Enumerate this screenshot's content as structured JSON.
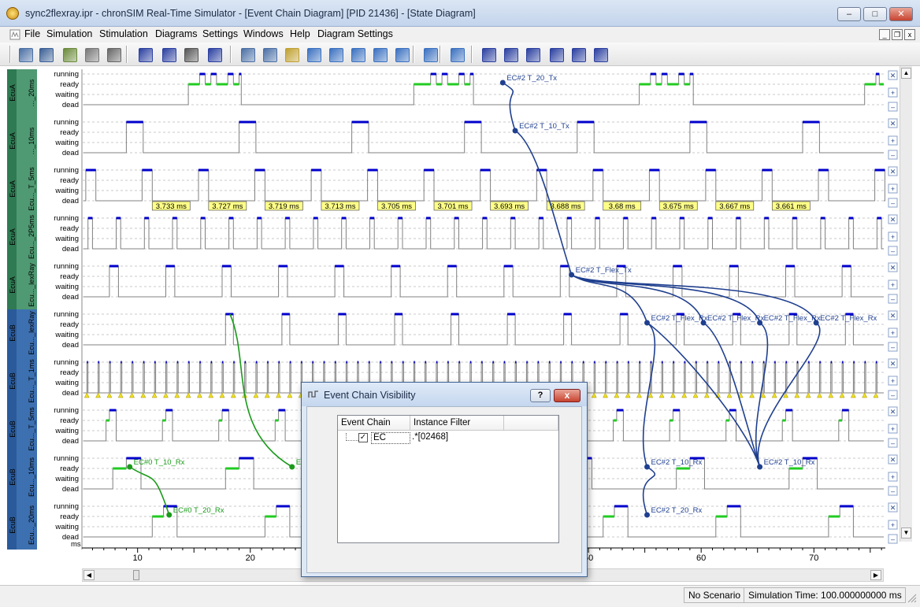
{
  "window": {
    "title": "sync2flexray.ipr - chronSIM Real-Time Simulator - [Event Chain Diagram] [PID 21436] - [State Diagram]",
    "minimize_label": "–",
    "maximize_label": "□",
    "close_label": "✕"
  },
  "menu": {
    "items": [
      "File",
      "Simulation",
      "Stimulation",
      "Diagrams",
      "Settings",
      "Windows",
      "Help",
      "Diagram Settings"
    ],
    "mdi_min": "_",
    "mdi_restore": "❐",
    "mdi_close": "x"
  },
  "toolbar": {
    "icons": [
      "open-project-icon",
      "save-tvc-icon",
      "settings-check-icon",
      "report-icon",
      "print-icon",
      "run-fast-icon",
      "step-icon",
      "pause-icon",
      "stop-icon",
      "state-diagram-icon",
      "text-diagram-icon",
      "chain-diagram-icon",
      "histogram-icon",
      "boxplot-icon",
      "curve-icon",
      "timeline-icon",
      "bracket-icon",
      "waveform-icon",
      "eye-icon",
      "add-row-icon",
      "remove-row-icon",
      "stack-icon",
      "zoom-in-icon",
      "zoom-out-icon",
      "menu-icon"
    ]
  },
  "chart_data": {
    "type": "state-diagram",
    "x_unit": "ms",
    "x_range": [
      5.2,
      76.2
    ],
    "x_ticks": [
      10,
      20,
      30,
      40,
      50,
      60,
      70
    ],
    "state_labels": [
      "running",
      "ready",
      "waiting",
      "dead"
    ],
    "colors": {
      "running": "#0000cc",
      "ready": "#22cc22",
      "event_chain_blue": "#1f3f8f",
      "event_chain_green": "#1a9a1a",
      "tag_fill": "#ffff88"
    },
    "rows": [
      {
        "ecu": "EcuA",
        "task": "..._20ms",
        "color": "#4f9a73",
        "color_ecu": "#2f7a53"
      },
      {
        "ecu": "EcuA",
        "task": "..._10ms",
        "color": "#4f9a73",
        "color_ecu": "#2f7a53"
      },
      {
        "ecu": "EcuA",
        "task": "Ecu..._T_5ms",
        "color": "#4f9a73",
        "color_ecu": "#2f7a53"
      },
      {
        "ecu": "EcuA",
        "task": "Ecu..._2P5ms",
        "color": "#4f9a73",
        "color_ecu": "#2f7a53"
      },
      {
        "ecu": "EcuA",
        "task": "Ecu..._lexRay",
        "color": "#4f9a73",
        "color_ecu": "#2f7a53"
      },
      {
        "ecu": "EcuB",
        "task": "Ecu..._lexRay",
        "color": "#3d70b0",
        "color_ecu": "#2a5a9a"
      },
      {
        "ecu": "EcuB",
        "task": "Ecu..._T_1ms",
        "color": "#3d70b0",
        "color_ecu": "#2a5a9a"
      },
      {
        "ecu": "EcuB",
        "task": "Ecu..._T_5ms",
        "color": "#3d70b0",
        "color_ecu": "#2a5a9a"
      },
      {
        "ecu": "EcuB",
        "task": "Ecu..._10ms",
        "color": "#3d70b0",
        "color_ecu": "#2a5a9a"
      },
      {
        "ecu": "EcuB",
        "task": "Ecu..._20ms",
        "color": "#3d70b0",
        "color_ecu": "#2a5a9a"
      }
    ],
    "period_tags": [
      "3.733 ms",
      "3.727 ms",
      "3.719 ms",
      "3.713 ms",
      "3.705 ms",
      "3.701 ms",
      "3.693 ms",
      "3.688 ms",
      "3.68 ms",
      "3.675 ms",
      "3.667 ms",
      "3.661 ms"
    ],
    "event_labels": [
      {
        "text": "EC#2 T_20_Tx",
        "t": 42.4,
        "row": 0,
        "color": "blue"
      },
      {
        "text": "EC#2 T_10_Tx",
        "t": 43.5,
        "row": 1,
        "color": "blue"
      },
      {
        "text": "EC#2 T_Flex_Tx",
        "t": 48.5,
        "row": 4,
        "color": "blue"
      },
      {
        "text": "EC#2 T_Flex_Rx",
        "t": 55.2,
        "row": 5,
        "color": "blue"
      },
      {
        "text": "EC#2 T_Flex_Rx",
        "t": 60.2,
        "row": 5,
        "color": "blue"
      },
      {
        "text": "EC#2 T_Flex_Rx",
        "t": 65.2,
        "row": 5,
        "color": "blue"
      },
      {
        "text": "EC#2 T_Flex_Rx",
        "t": 70.2,
        "row": 5,
        "color": "blue"
      },
      {
        "text": "EC#2 T_10_Rx",
        "t": 55.2,
        "row": 8,
        "color": "blue"
      },
      {
        "text": "EC#2 T_10_Rx",
        "t": 65.2,
        "row": 8,
        "color": "blue"
      },
      {
        "text": "EC#2 T_20_Rx",
        "t": 55.2,
        "row": 9,
        "color": "blue"
      },
      {
        "text": "EC#0 T_10_Rx",
        "t": 9.3,
        "row": 8,
        "color": "green"
      },
      {
        "text": "EC#0 T_10_Rx",
        "t": 23.7,
        "row": 8,
        "color": "green"
      },
      {
        "text": "EC#0 T_20_Rx",
        "t": 12.8,
        "row": 9,
        "color": "green"
      }
    ]
  },
  "dialog": {
    "title": "Event Chain Visibility",
    "help_label": "?",
    "close_label": "x",
    "col_event_chain": "Event Chain",
    "col_instance_filter": "Instance Filter",
    "row": {
      "checked": "✓",
      "name": "EC",
      "filter": ".*[02468]"
    }
  },
  "status": {
    "scenario": "No Scenario",
    "simulation_time": "Simulation Time: 100.000000000 ms"
  }
}
